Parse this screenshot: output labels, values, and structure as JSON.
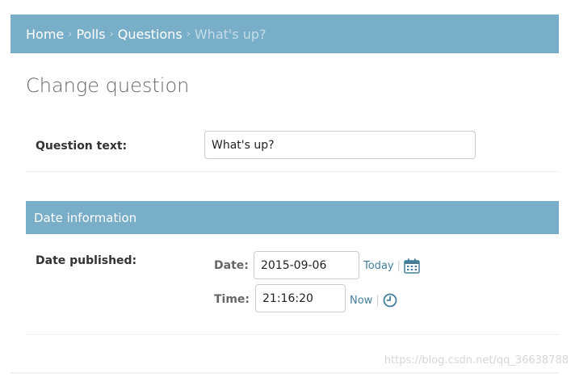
{
  "breadcrumb": {
    "home": "Home",
    "polls": "Polls",
    "questions": "Questions",
    "current": "What's up?",
    "separator": "›"
  },
  "page_title": "Change question",
  "question_row": {
    "label": "Question text:",
    "value": "What's up?"
  },
  "date_section": {
    "title": "Date information",
    "label": "Date published:",
    "date_label": "Date:",
    "date_value": "2015-09-06",
    "today_link": "Today",
    "time_label": "Time:",
    "time_value": "21:16:20",
    "now_link": "Now",
    "separator": "|",
    "calendar_icon": "calendar-icon",
    "clock_icon": "clock-icon"
  },
  "watermark": "https://blog.csdn.net/qq_36638788",
  "colors": {
    "header_bg": "#79aec8",
    "link": "#447e9b"
  }
}
